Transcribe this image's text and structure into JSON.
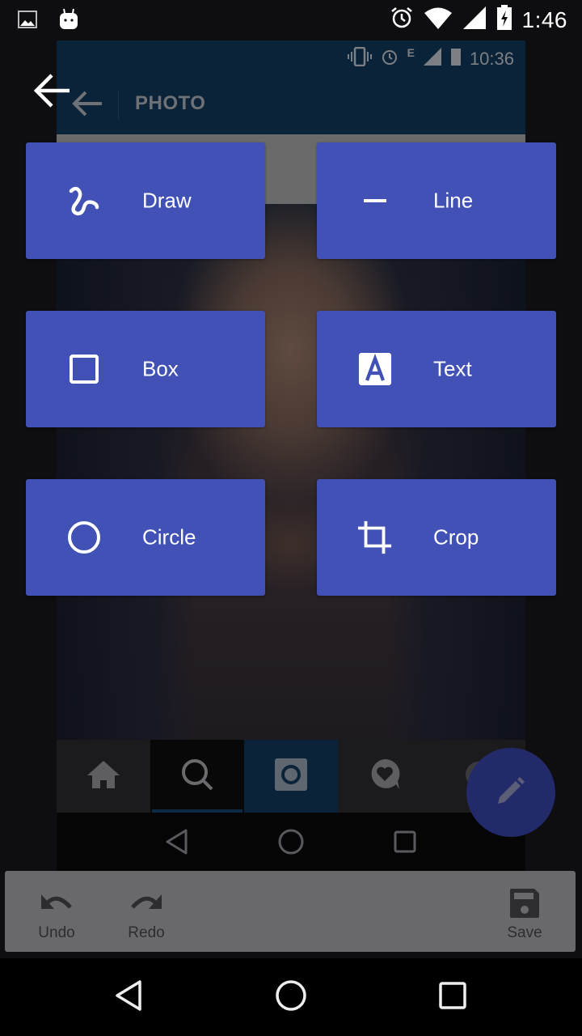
{
  "status_bar": {
    "time": "1:46",
    "left_icons": [
      "image-icon",
      "android-icon"
    ],
    "right_icons": [
      "alarm-icon",
      "wifi-icon",
      "signal-icon",
      "battery-charging-icon"
    ]
  },
  "embedded_screenshot": {
    "status_bar": {
      "time": "10:36",
      "network_type": "E",
      "icons": [
        "vibrate-icon",
        "alarm-icon",
        "signal-icon",
        "battery-icon"
      ]
    },
    "toolbar": {
      "title": "PHOTO"
    },
    "bottom_nav": [
      "home-icon",
      "search-icon",
      "camera-icon",
      "activity-icon",
      "profile-icon"
    ]
  },
  "tools": [
    {
      "label": "Draw",
      "icon": "squiggle-icon"
    },
    {
      "label": "Line",
      "icon": "line-icon"
    },
    {
      "label": "Box",
      "icon": "square-icon"
    },
    {
      "label": "Text",
      "icon": "text-icon"
    },
    {
      "label": "Circle",
      "icon": "circle-icon"
    },
    {
      "label": "Crop",
      "icon": "crop-icon"
    }
  ],
  "fab": {
    "icon": "pencil-icon"
  },
  "action_bar": {
    "undo_label": "Undo",
    "redo_label": "Redo",
    "save_label": "Save"
  },
  "colors": {
    "tool_button": "#4151b5",
    "fab": "#232a6a",
    "action_bar": "#69686b"
  }
}
